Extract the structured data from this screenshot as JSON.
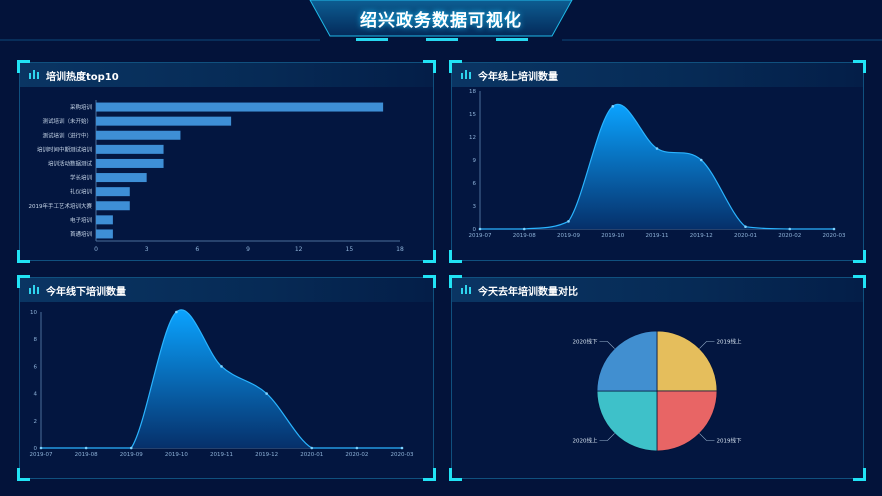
{
  "header": {
    "title": "绍兴政务数据可视化"
  },
  "panels": {
    "p1": {
      "title": "培训热度top10"
    },
    "p2": {
      "title": "今年线上培训数量"
    },
    "p3": {
      "title": "今年线下培训数量"
    },
    "p4": {
      "title": "今天去年培训数量对比"
    }
  },
  "colors": {
    "bar": "#3e8fd6",
    "axis": "#8fb3d9",
    "area_top": "#0aa3ff",
    "area_bottom": "#06306a"
  },
  "chart_data": [
    {
      "type": "bar",
      "orientation": "horizontal",
      "categories": [
        "采购培训",
        "测试培训（未开始）",
        "测试培训（进行中）",
        "培训时间中期测试培训",
        "培训活动数据测试",
        "学长培训",
        "礼仪培训",
        "2019年手工艺术培训大赛",
        "电子培训",
        "首通培训"
      ],
      "values": [
        17,
        8,
        5,
        4,
        4,
        3,
        2,
        2,
        1,
        1
      ],
      "xticks": [
        "0",
        "3",
        "6",
        "9",
        "12",
        "15",
        "18"
      ],
      "xlim": [
        0,
        18
      ]
    },
    {
      "type": "area",
      "categories": [
        "2019-07",
        "2019-08",
        "2019-09",
        "2019-10",
        "2019-11",
        "2019-12",
        "2020-01",
        "2020-02",
        "2020-03"
      ],
      "values": [
        0,
        0,
        1,
        16,
        10.5,
        9,
        0.3,
        0,
        0
      ],
      "yticks": [
        "0",
        "3",
        "6",
        "9",
        "12",
        "15",
        "18"
      ],
      "ylim": [
        0,
        18
      ]
    },
    {
      "type": "area",
      "categories": [
        "2019-07",
        "2019-08",
        "2019-09",
        "2019-10",
        "2019-11",
        "2019-12",
        "2020-01",
        "2020-02",
        "2020-03"
      ],
      "values": [
        0,
        0,
        0,
        10,
        6,
        4,
        0,
        0,
        0
      ],
      "yticks": [
        "0",
        "2",
        "4",
        "6",
        "8",
        "10"
      ],
      "ylim": [
        0,
        10
      ]
    },
    {
      "type": "pie",
      "slices": [
        {
          "label": "2019线上",
          "value": 25,
          "color": "#e5be5c"
        },
        {
          "label": "2019线下",
          "value": 25,
          "color": "#e86565"
        },
        {
          "label": "2020线上",
          "value": 25,
          "color": "#3ec1c9"
        },
        {
          "label": "2020线下",
          "value": 25,
          "color": "#418fd0"
        }
      ]
    }
  ]
}
